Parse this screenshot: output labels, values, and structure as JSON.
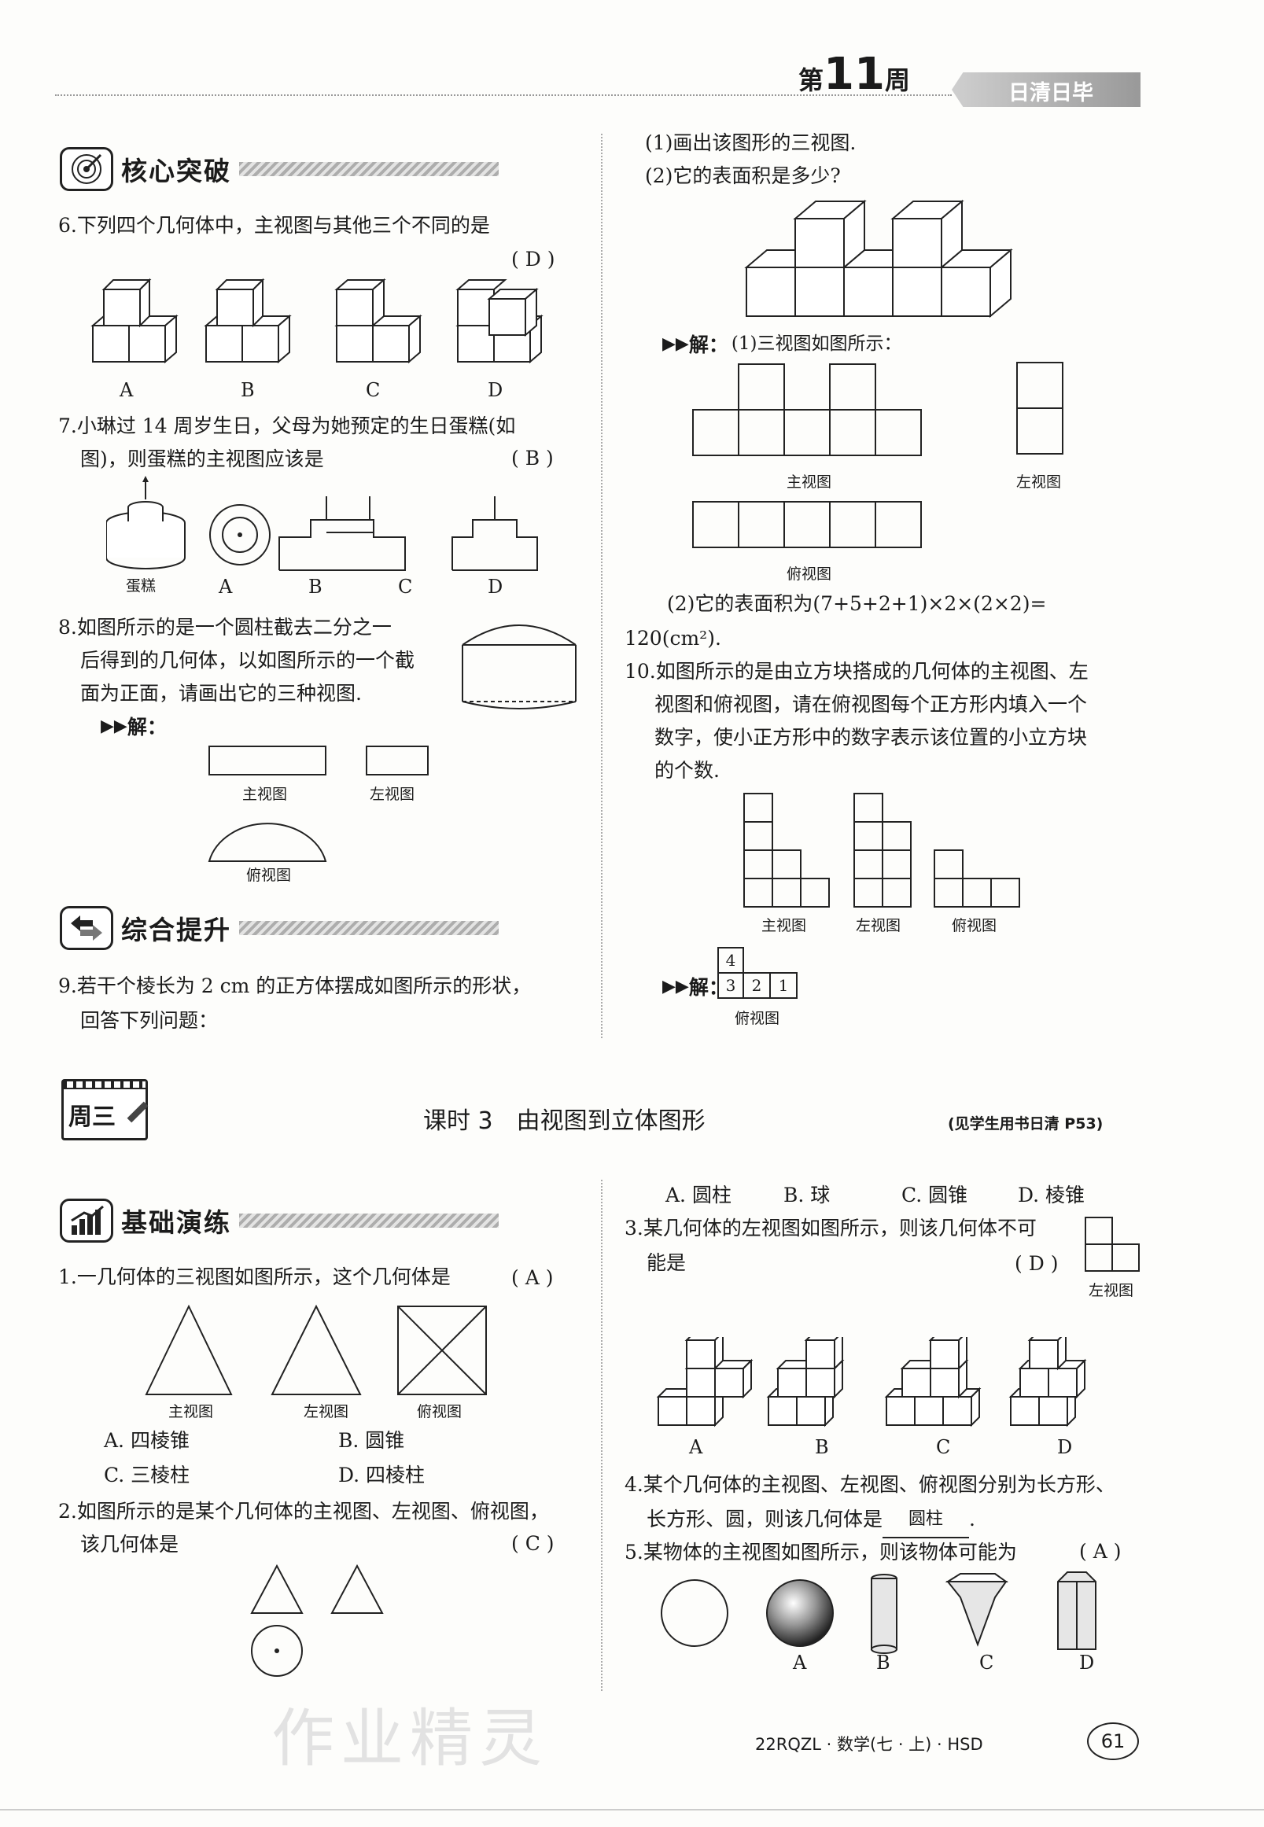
{
  "header": {
    "week_prefix": "第",
    "week_num": "11",
    "week_suffix": "周",
    "tag": "日清日毕"
  },
  "sections": {
    "core": "核心突破",
    "combo": "综合提升",
    "basic": "基础演练"
  },
  "q6": {
    "text": "6.下列四个几何体中，主视图与其他三个不同的是",
    "answer": "( D )",
    "labels": [
      "A",
      "B",
      "C",
      "D"
    ]
  },
  "q7": {
    "line1": "7.小琳过 14 周岁生日，父母为她预定的生日蛋糕(如",
    "line2": "图)，则蛋糕的主视图应该是",
    "answer": "( B )",
    "cake_label": "蛋糕",
    "labels": [
      "A",
      "B",
      "C",
      "D"
    ]
  },
  "q8": {
    "line1": "8.如图所示的是一个圆柱截去二分之一",
    "line2": "后得到的几何体，以如图所示的一个截",
    "line3": "面为正面，请画出它的三种视图.",
    "solve": "解：",
    "front": "主视图",
    "left": "左视图",
    "top": "俯视图"
  },
  "q9": {
    "line1": "9.若干个棱长为 2 cm 的正方体摆成如图所示的形状，",
    "line2": "回答下列问题：",
    "p1": "(1)画出该图形的三视图.",
    "p2": "(2)它的表面积是多少?",
    "solve": "解：",
    "sol1": "(1)三视图如图所示：",
    "front": "主视图",
    "left": "左视图",
    "top": "俯视图",
    "sol2a": "(2)它的表面积为(7+5+2+1)×2×(2×2)=",
    "sol2b": "120(cm²)."
  },
  "q10": {
    "line1": "10.如图所示的是由立方块搭成的几何体的主视图、左",
    "line2": "视图和俯视图，请在俯视图每个正方形内填入一个",
    "line3": "数字，使小正方形中的数字表示该位置的小立方块",
    "line4": "的个数.",
    "front": "主视图",
    "left": "左视图",
    "top": "俯视图",
    "solve": "解：",
    "grid_top": "4",
    "grid_row": [
      "3",
      "2",
      "1"
    ],
    "grid_caption": "俯视图"
  },
  "lesson": {
    "day": "周三",
    "title": "课时 3　由视图到立体图形",
    "ref": "(见学生用书日清 P53)"
  },
  "b1": {
    "text": "1.一几何体的三视图如图所示，这个几何体是",
    "answer": "( A )",
    "front": "主视图",
    "left": "左视图",
    "top": "俯视图",
    "optA": "A. 四棱锥",
    "optB": "B. 圆锥",
    "optC": "C. 三棱柱",
    "optD": "D. 四棱柱"
  },
  "b2": {
    "line1": "2.如图所示的是某个几何体的主视图、左视图、俯视图，",
    "line2": "该几何体是",
    "answer": "( C )",
    "opts": [
      "A. 圆柱",
      "B. 球",
      "C. 圆锥",
      "D. 棱锥"
    ]
  },
  "b3": {
    "line1": "3.某几何体的左视图如图所示，则该几何体不可",
    "line2": "能是",
    "answer": "( D )",
    "caption": "左视图",
    "labels": [
      "A",
      "B",
      "C",
      "D"
    ]
  },
  "b4": {
    "text": "4.某个几何体的主视图、左视图、俯视图分别为长方形、",
    "line2_pre": "长方形、圆，则该几何体是",
    "blank": "圆柱",
    "line2_post": "."
  },
  "b5": {
    "text": "5.某物体的主视图如图所示，则该物体可能为",
    "answer": "( A )",
    "labels": [
      "A",
      "B",
      "C",
      "D"
    ]
  },
  "footer": {
    "code": "22RQZL · 数学(七 · 上) · HSD",
    "page": "61"
  },
  "watermark": "作业精灵"
}
